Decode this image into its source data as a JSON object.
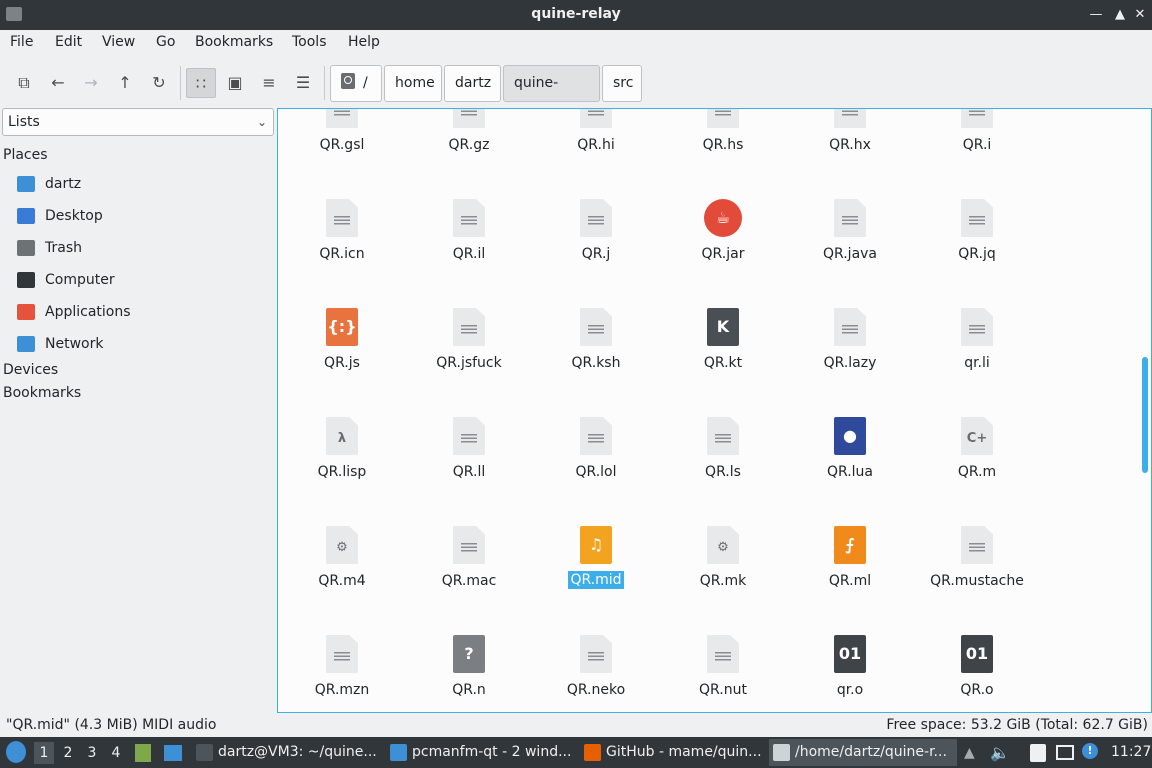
{
  "window": {
    "title": "quine-relay"
  },
  "menu": [
    "File",
    "Edit",
    "View",
    "Go",
    "Bookmarks",
    "Tools",
    "Help"
  ],
  "toolbar": {
    "buttons": [
      "new-window-icon",
      "back-icon",
      "forward-icon",
      "up-icon",
      "reload-icon",
      "icon-view-icon",
      "thumbnail-view-icon",
      "compact-view-icon",
      "detailed-list-icon"
    ]
  },
  "breadcrumb": {
    "root": "/",
    "segments": [
      "home",
      "dartz",
      "quine-relay",
      "src"
    ],
    "active": "quine-relay"
  },
  "sidebar": {
    "selector": "Lists",
    "places_header": "Places",
    "places": [
      {
        "label": "dartz",
        "icon": "home-folder-icon",
        "color": "#3d8fd6"
      },
      {
        "label": "Desktop",
        "icon": "desktop-icon",
        "color": "#3a7bd5"
      },
      {
        "label": "Trash",
        "icon": "trash-icon",
        "color": "#6d7275"
      },
      {
        "label": "Computer",
        "icon": "computer-icon",
        "color": "#31363b"
      },
      {
        "label": "Applications",
        "icon": "applications-icon",
        "color": "#e5533d"
      },
      {
        "label": "Network",
        "icon": "network-icon",
        "color": "#3d8fd6"
      }
    ],
    "devices_header": "Devices",
    "bookmarks_header": "Bookmarks"
  },
  "files": [
    {
      "name": "QR.gsl",
      "icon": "text-icon"
    },
    {
      "name": "QR.gz",
      "icon": "archive-icon"
    },
    {
      "name": "QR.hi",
      "icon": "text-icon"
    },
    {
      "name": "QR.hs",
      "icon": "text-icon"
    },
    {
      "name": "QR.hx",
      "icon": "text-icon"
    },
    {
      "name": "QR.i",
      "icon": "text-icon"
    },
    {
      "name": "QR.icn",
      "icon": "text-icon"
    },
    {
      "name": "QR.il",
      "icon": "text-icon"
    },
    {
      "name": "QR.j",
      "icon": "text-icon"
    },
    {
      "name": "QR.jar",
      "icon": "java-archive-icon"
    },
    {
      "name": "QR.java",
      "icon": "java-source-icon"
    },
    {
      "name": "QR.jq",
      "icon": "text-icon"
    },
    {
      "name": "QR.js",
      "icon": "javascript-icon"
    },
    {
      "name": "QR.jsfuck",
      "icon": "text-icon"
    },
    {
      "name": "QR.ksh",
      "icon": "text-icon"
    },
    {
      "name": "QR.kt",
      "icon": "kotlin-icon"
    },
    {
      "name": "QR.lazy",
      "icon": "text-icon"
    },
    {
      "name": "qr.li",
      "icon": "text-icon"
    },
    {
      "name": "QR.lisp",
      "icon": "lisp-icon"
    },
    {
      "name": "QR.ll",
      "icon": "text-icon"
    },
    {
      "name": "QR.lol",
      "icon": "text-icon"
    },
    {
      "name": "QR.ls",
      "icon": "text-icon"
    },
    {
      "name": "QR.lua",
      "icon": "lua-icon"
    },
    {
      "name": "QR.m",
      "icon": "objc-icon"
    },
    {
      "name": "QR.m4",
      "icon": "config-icon"
    },
    {
      "name": "QR.mac",
      "icon": "text-icon"
    },
    {
      "name": "QR.mid",
      "icon": "midi-audio-icon",
      "selected": true
    },
    {
      "name": "QR.mk",
      "icon": "config-icon"
    },
    {
      "name": "QR.ml",
      "icon": "ocaml-icon"
    },
    {
      "name": "QR.mustache",
      "icon": "text-icon"
    },
    {
      "name": "QR.mzn",
      "icon": "text-icon"
    },
    {
      "name": "QR.n",
      "icon": "unknown-icon"
    },
    {
      "name": "QR.neko",
      "icon": "text-icon"
    },
    {
      "name": "QR.nut",
      "icon": "text-icon"
    },
    {
      "name": "qr.o",
      "icon": "binary-icon"
    },
    {
      "name": "QR.o",
      "icon": "binary-icon"
    }
  ],
  "status": {
    "selection": "\"QR.mid\" (4.3 MiB) MIDI audio",
    "free_space": "Free space: 53.2 GiB (Total: 62.7 GiB)"
  },
  "taskbar": {
    "desktops": [
      "1",
      "2",
      "3",
      "4"
    ],
    "active_desktop": "1",
    "tasks": [
      {
        "label": "dartz@VM3: ~/quine...",
        "icon": "terminal-icon",
        "color": "#4d545a",
        "active": false
      },
      {
        "label": "pcmanfm-qt - 2 wind...",
        "icon": "folder-icon",
        "color": "#3d8fd6",
        "active": false
      },
      {
        "label": "GitHub - mame/quin...",
        "icon": "firefox-icon",
        "color": "#e66000",
        "active": false
      },
      {
        "label": "/home/dartz/quine-r...",
        "icon": "editor-icon",
        "color": "#d0d3d6",
        "active": true
      }
    ],
    "clock": "11:27"
  },
  "colors": {
    "accent": "#3daee9",
    "titlebar": "#31363b"
  }
}
